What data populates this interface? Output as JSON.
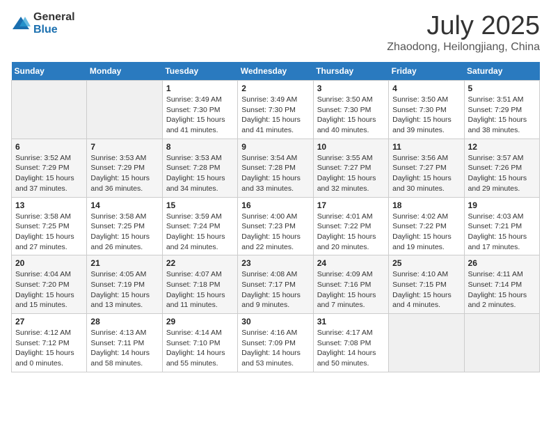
{
  "header": {
    "logo": {
      "general": "General",
      "blue": "Blue"
    },
    "month": "July 2025",
    "location": "Zhaodong, Heilongjiang, China"
  },
  "days_of_week": [
    "Sunday",
    "Monday",
    "Tuesday",
    "Wednesday",
    "Thursday",
    "Friday",
    "Saturday"
  ],
  "weeks": [
    [
      {
        "day": "",
        "detail": ""
      },
      {
        "day": "",
        "detail": ""
      },
      {
        "day": "1",
        "detail": "Sunrise: 3:49 AM\nSunset: 7:30 PM\nDaylight: 15 hours\nand 41 minutes."
      },
      {
        "day": "2",
        "detail": "Sunrise: 3:49 AM\nSunset: 7:30 PM\nDaylight: 15 hours\nand 41 minutes."
      },
      {
        "day": "3",
        "detail": "Sunrise: 3:50 AM\nSunset: 7:30 PM\nDaylight: 15 hours\nand 40 minutes."
      },
      {
        "day": "4",
        "detail": "Sunrise: 3:50 AM\nSunset: 7:30 PM\nDaylight: 15 hours\nand 39 minutes."
      },
      {
        "day": "5",
        "detail": "Sunrise: 3:51 AM\nSunset: 7:29 PM\nDaylight: 15 hours\nand 38 minutes."
      }
    ],
    [
      {
        "day": "6",
        "detail": "Sunrise: 3:52 AM\nSunset: 7:29 PM\nDaylight: 15 hours\nand 37 minutes."
      },
      {
        "day": "7",
        "detail": "Sunrise: 3:53 AM\nSunset: 7:29 PM\nDaylight: 15 hours\nand 36 minutes."
      },
      {
        "day": "8",
        "detail": "Sunrise: 3:53 AM\nSunset: 7:28 PM\nDaylight: 15 hours\nand 34 minutes."
      },
      {
        "day": "9",
        "detail": "Sunrise: 3:54 AM\nSunset: 7:28 PM\nDaylight: 15 hours\nand 33 minutes."
      },
      {
        "day": "10",
        "detail": "Sunrise: 3:55 AM\nSunset: 7:27 PM\nDaylight: 15 hours\nand 32 minutes."
      },
      {
        "day": "11",
        "detail": "Sunrise: 3:56 AM\nSunset: 7:27 PM\nDaylight: 15 hours\nand 30 minutes."
      },
      {
        "day": "12",
        "detail": "Sunrise: 3:57 AM\nSunset: 7:26 PM\nDaylight: 15 hours\nand 29 minutes."
      }
    ],
    [
      {
        "day": "13",
        "detail": "Sunrise: 3:58 AM\nSunset: 7:25 PM\nDaylight: 15 hours\nand 27 minutes."
      },
      {
        "day": "14",
        "detail": "Sunrise: 3:58 AM\nSunset: 7:25 PM\nDaylight: 15 hours\nand 26 minutes."
      },
      {
        "day": "15",
        "detail": "Sunrise: 3:59 AM\nSunset: 7:24 PM\nDaylight: 15 hours\nand 24 minutes."
      },
      {
        "day": "16",
        "detail": "Sunrise: 4:00 AM\nSunset: 7:23 PM\nDaylight: 15 hours\nand 22 minutes."
      },
      {
        "day": "17",
        "detail": "Sunrise: 4:01 AM\nSunset: 7:22 PM\nDaylight: 15 hours\nand 20 minutes."
      },
      {
        "day": "18",
        "detail": "Sunrise: 4:02 AM\nSunset: 7:22 PM\nDaylight: 15 hours\nand 19 minutes."
      },
      {
        "day": "19",
        "detail": "Sunrise: 4:03 AM\nSunset: 7:21 PM\nDaylight: 15 hours\nand 17 minutes."
      }
    ],
    [
      {
        "day": "20",
        "detail": "Sunrise: 4:04 AM\nSunset: 7:20 PM\nDaylight: 15 hours\nand 15 minutes."
      },
      {
        "day": "21",
        "detail": "Sunrise: 4:05 AM\nSunset: 7:19 PM\nDaylight: 15 hours\nand 13 minutes."
      },
      {
        "day": "22",
        "detail": "Sunrise: 4:07 AM\nSunset: 7:18 PM\nDaylight: 15 hours\nand 11 minutes."
      },
      {
        "day": "23",
        "detail": "Sunrise: 4:08 AM\nSunset: 7:17 PM\nDaylight: 15 hours\nand 9 minutes."
      },
      {
        "day": "24",
        "detail": "Sunrise: 4:09 AM\nSunset: 7:16 PM\nDaylight: 15 hours\nand 7 minutes."
      },
      {
        "day": "25",
        "detail": "Sunrise: 4:10 AM\nSunset: 7:15 PM\nDaylight: 15 hours\nand 4 minutes."
      },
      {
        "day": "26",
        "detail": "Sunrise: 4:11 AM\nSunset: 7:14 PM\nDaylight: 15 hours\nand 2 minutes."
      }
    ],
    [
      {
        "day": "27",
        "detail": "Sunrise: 4:12 AM\nSunset: 7:12 PM\nDaylight: 15 hours\nand 0 minutes."
      },
      {
        "day": "28",
        "detail": "Sunrise: 4:13 AM\nSunset: 7:11 PM\nDaylight: 14 hours\nand 58 minutes."
      },
      {
        "day": "29",
        "detail": "Sunrise: 4:14 AM\nSunset: 7:10 PM\nDaylight: 14 hours\nand 55 minutes."
      },
      {
        "day": "30",
        "detail": "Sunrise: 4:16 AM\nSunset: 7:09 PM\nDaylight: 14 hours\nand 53 minutes."
      },
      {
        "day": "31",
        "detail": "Sunrise: 4:17 AM\nSunset: 7:08 PM\nDaylight: 14 hours\nand 50 minutes."
      },
      {
        "day": "",
        "detail": ""
      },
      {
        "day": "",
        "detail": ""
      }
    ]
  ]
}
